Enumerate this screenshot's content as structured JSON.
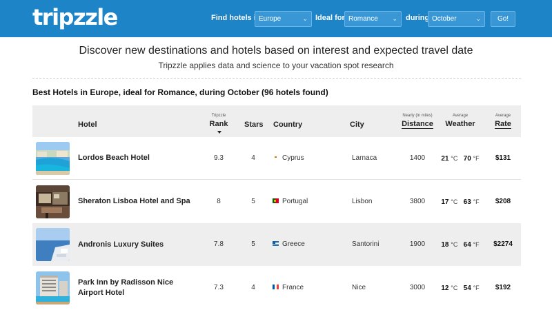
{
  "header": {
    "logo": "tripzzle",
    "find_label": "Find hotels in",
    "region": "Europe",
    "ideal_label": "Ideal for",
    "interest": "Romance",
    "during_label": "during",
    "month": "October",
    "go_label": "Go!"
  },
  "intro": {
    "headline": "Discover new destinations and hotels based on interest and expected travel date",
    "subline": "Tripzzle applies data and science to your vacation spot research"
  },
  "results_title": "Best Hotels in Europe, ideal for Romance, during October (96 hotels found)",
  "table": {
    "headers": {
      "hotel": "Hotel",
      "rank_small": "Tripzzle",
      "rank": "Rank",
      "stars": "Stars",
      "country": "Country",
      "city": "City",
      "distance_small": "Nearly (in miles)",
      "distance": "Distance",
      "weather_small": "Average",
      "weather": "Weather",
      "rate_small": "Average",
      "rate": "Rate"
    },
    "rows": [
      {
        "name": "Lordos Beach Hotel",
        "rank": "9.3",
        "stars": "4",
        "country": "Cyprus",
        "city": "Larnaca",
        "distance": "1400",
        "temp_c": "21",
        "temp_f": "70",
        "unit_c": "°C",
        "unit_f": "°F",
        "rate": "$131"
      },
      {
        "name": "Sheraton Lisboa Hotel and Spa",
        "rank": "8",
        "stars": "5",
        "country": "Portugal",
        "city": "Lisbon",
        "distance": "3800",
        "temp_c": "17",
        "temp_f": "63",
        "unit_c": "°C",
        "unit_f": "°F",
        "rate": "$208"
      },
      {
        "name": "Andronis Luxury Suites",
        "rank": "7.8",
        "stars": "5",
        "country": "Greece",
        "city": "Santorini",
        "distance": "1900",
        "temp_c": "18",
        "temp_f": "64",
        "unit_c": "°C",
        "unit_f": "°F",
        "rate": "$2274"
      },
      {
        "name": "Park Inn by Radisson Nice Airport Hotel",
        "rank": "7.3",
        "stars": "4",
        "country": "France",
        "city": "Nice",
        "distance": "3000",
        "temp_c": "12",
        "temp_f": "54",
        "unit_c": "°C",
        "unit_f": "°F",
        "rate": "$192"
      }
    ]
  },
  "colors": {
    "header_bg": "#1e84c8",
    "row_alt_bg": "#eeeeee"
  },
  "icons": {
    "select_arrow": "chevron-down-icon",
    "sort_arrow": "sort-down-icon"
  }
}
